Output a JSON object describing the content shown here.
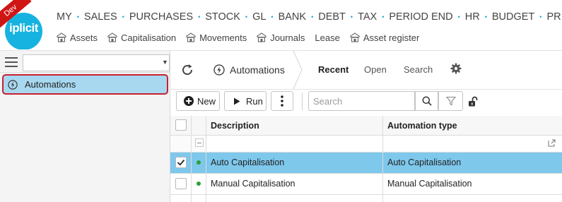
{
  "app": {
    "logo_text": "iplicit",
    "environment_badge": "Dev",
    "accent_color": "#17b3e0",
    "badge_color": "#d01515"
  },
  "main_menu": [
    {
      "label": "MY"
    },
    {
      "label": "SALES"
    },
    {
      "label": "PURCHASES"
    },
    {
      "label": "STOCK"
    },
    {
      "label": "GL"
    },
    {
      "label": "BANK"
    },
    {
      "label": "DEBT"
    },
    {
      "label": "TAX"
    },
    {
      "label": "PERIOD END"
    },
    {
      "label": "HR"
    },
    {
      "label": "BUDGET"
    },
    {
      "label": "PR"
    }
  ],
  "sub_menu": [
    {
      "label": "Assets",
      "icon": "building-icon"
    },
    {
      "label": "Capitalisation",
      "icon": "building-icon"
    },
    {
      "label": "Movements",
      "icon": "building-icon"
    },
    {
      "label": "Journals",
      "icon": "building-icon"
    },
    {
      "label": "Lease",
      "icon": null
    },
    {
      "label": "Asset register",
      "icon": "building-icon"
    }
  ],
  "left_pane": {
    "selector_value": "",
    "nav_items": [
      {
        "label": "Automations",
        "icon": "lightning-icon",
        "selected": true
      }
    ],
    "selection_color": "#a8d8f0",
    "highlight_border_color": "#c8202f"
  },
  "toolbar": {
    "module_label": "Automations",
    "tabs": [
      {
        "label": "Recent",
        "active": true
      },
      {
        "label": "Open",
        "active": false
      },
      {
        "label": "Search",
        "active": false
      }
    ]
  },
  "actions": {
    "new_label": "New",
    "run_label": "Run",
    "search_placeholder": "Search"
  },
  "grid": {
    "columns": [
      {
        "label": ""
      },
      {
        "label": ""
      },
      {
        "label": "Description"
      },
      {
        "label": "Automation type"
      }
    ],
    "rows": [
      {
        "description": "Auto Capitalisation",
        "automation_type": "Auto Capitalisation",
        "checked": true,
        "selected": true,
        "status_color": "#2e9e3a"
      },
      {
        "description": "Manual Capitalisation",
        "automation_type": "Manual Capitalisation",
        "checked": false,
        "selected": false,
        "status_color": "#2e9e3a"
      }
    ],
    "selected_row_color": "#7ec8ec"
  }
}
